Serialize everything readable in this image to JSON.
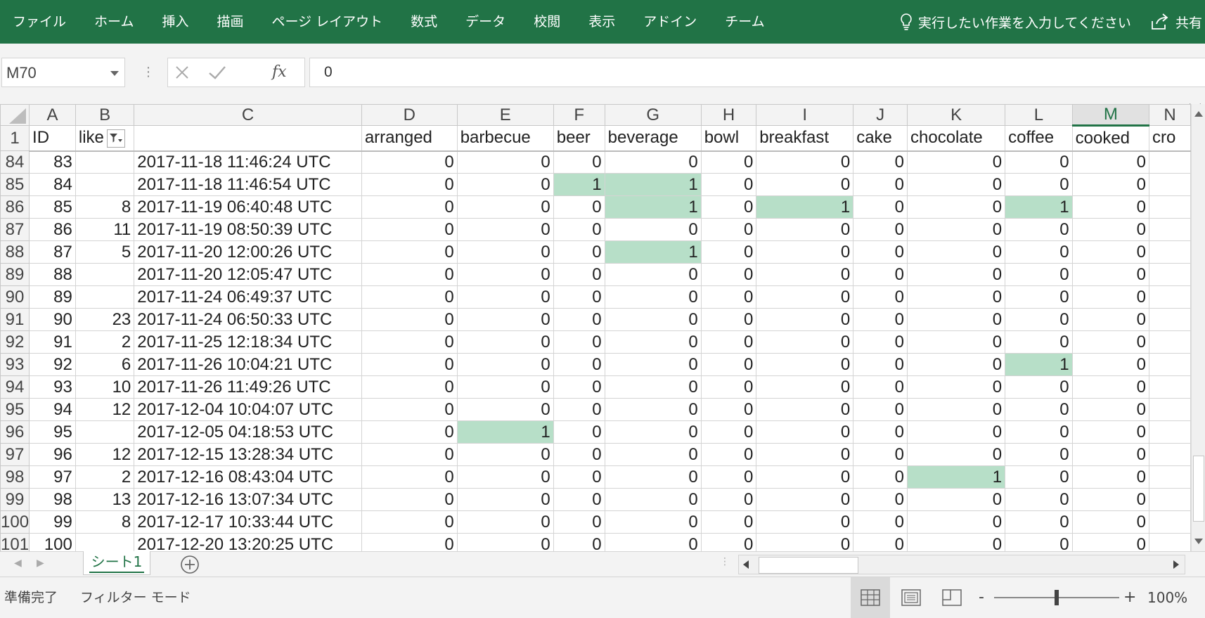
{
  "ribbon": {
    "tabs": [
      "ファイル",
      "ホーム",
      "挿入",
      "描画",
      "ページ レイアウト",
      "数式",
      "データ",
      "校閲",
      "表示",
      "アドイン",
      "チーム"
    ],
    "tell_me": "実行したい作業を入力してください",
    "share": "共有"
  },
  "formula_bar": {
    "name_box": "M70",
    "formula": "0"
  },
  "grid": {
    "columns": [
      "A",
      "B",
      "C",
      "D",
      "E",
      "F",
      "G",
      "H",
      "I",
      "J",
      "K",
      "L",
      "M",
      "N"
    ],
    "selected_column": "M",
    "headers": [
      "ID",
      "like",
      "",
      "arranged",
      "barbecue",
      "beer",
      "beverage",
      "bowl",
      "breakfast",
      "cake",
      "chocolate",
      "coffee",
      "cooked",
      "cro"
    ],
    "header_row_number": "1",
    "rows": [
      {
        "n": "84",
        "cells": [
          "83",
          "",
          "2017-11-18 11:46:24 UTC",
          "0",
          "0",
          "0",
          "0",
          "0",
          "0",
          "0",
          "0",
          "0",
          "0"
        ]
      },
      {
        "n": "85",
        "cells": [
          "84",
          "",
          "2017-11-18 11:46:54 UTC",
          "0",
          "0",
          "1",
          "1",
          "0",
          "0",
          "0",
          "0",
          "0",
          "0"
        ]
      },
      {
        "n": "86",
        "cells": [
          "85",
          "8",
          "2017-11-19 06:40:48 UTC",
          "0",
          "0",
          "0",
          "1",
          "0",
          "1",
          "0",
          "0",
          "1",
          "0"
        ]
      },
      {
        "n": "87",
        "cells": [
          "86",
          "11",
          "2017-11-19 08:50:39 UTC",
          "0",
          "0",
          "0",
          "0",
          "0",
          "0",
          "0",
          "0",
          "0",
          "0"
        ]
      },
      {
        "n": "88",
        "cells": [
          "87",
          "5",
          "2017-11-20 12:00:26 UTC",
          "0",
          "0",
          "0",
          "1",
          "0",
          "0",
          "0",
          "0",
          "0",
          "0"
        ]
      },
      {
        "n": "89",
        "cells": [
          "88",
          "",
          "2017-11-20 12:05:47 UTC",
          "0",
          "0",
          "0",
          "0",
          "0",
          "0",
          "0",
          "0",
          "0",
          "0"
        ]
      },
      {
        "n": "90",
        "cells": [
          "89",
          "",
          "2017-11-24 06:49:37 UTC",
          "0",
          "0",
          "0",
          "0",
          "0",
          "0",
          "0",
          "0",
          "0",
          "0"
        ]
      },
      {
        "n": "91",
        "cells": [
          "90",
          "23",
          "2017-11-24 06:50:33 UTC",
          "0",
          "0",
          "0",
          "0",
          "0",
          "0",
          "0",
          "0",
          "0",
          "0"
        ]
      },
      {
        "n": "92",
        "cells": [
          "91",
          "2",
          "2017-11-25 12:18:34 UTC",
          "0",
          "0",
          "0",
          "0",
          "0",
          "0",
          "0",
          "0",
          "0",
          "0"
        ]
      },
      {
        "n": "93",
        "cells": [
          "92",
          "6",
          "2017-11-26 10:04:21 UTC",
          "0",
          "0",
          "0",
          "0",
          "0",
          "0",
          "0",
          "0",
          "1",
          "0"
        ]
      },
      {
        "n": "94",
        "cells": [
          "93",
          "10",
          "2017-11-26 11:49:26 UTC",
          "0",
          "0",
          "0",
          "0",
          "0",
          "0",
          "0",
          "0",
          "0",
          "0"
        ]
      },
      {
        "n": "95",
        "cells": [
          "94",
          "12",
          "2017-12-04 10:04:07 UTC",
          "0",
          "0",
          "0",
          "0",
          "0",
          "0",
          "0",
          "0",
          "0",
          "0"
        ]
      },
      {
        "n": "96",
        "cells": [
          "95",
          "",
          "2017-12-05 04:18:53 UTC",
          "0",
          "1",
          "0",
          "0",
          "0",
          "0",
          "0",
          "0",
          "0",
          "0"
        ]
      },
      {
        "n": "97",
        "cells": [
          "96",
          "12",
          "2017-12-15 13:28:34 UTC",
          "0",
          "0",
          "0",
          "0",
          "0",
          "0",
          "0",
          "0",
          "0",
          "0"
        ]
      },
      {
        "n": "98",
        "cells": [
          "97",
          "2",
          "2017-12-16 08:43:04 UTC",
          "0",
          "0",
          "0",
          "0",
          "0",
          "0",
          "0",
          "1",
          "0",
          "0"
        ]
      },
      {
        "n": "99",
        "cells": [
          "98",
          "13",
          "2017-12-16 13:07:34 UTC",
          "0",
          "0",
          "0",
          "0",
          "0",
          "0",
          "0",
          "0",
          "0",
          "0"
        ]
      },
      {
        "n": "100",
        "cells": [
          "99",
          "8",
          "2017-12-17 10:33:44 UTC",
          "0",
          "0",
          "0",
          "0",
          "0",
          "0",
          "0",
          "0",
          "0",
          "0"
        ]
      },
      {
        "n": "101",
        "cells": [
          "100",
          "",
          "2017-12-20 13:20:25 UTC",
          "0",
          "0",
          "0",
          "0",
          "0",
          "0",
          "0",
          "0",
          "0",
          "0"
        ]
      }
    ]
  },
  "sheet_tabs": [
    "シート1"
  ],
  "status": {
    "ready": "準備完了",
    "filter_mode": "フィルター モード",
    "zoom": "100%"
  },
  "colors": {
    "ribbon": "#217346",
    "highlight": "#b7dfc8"
  }
}
